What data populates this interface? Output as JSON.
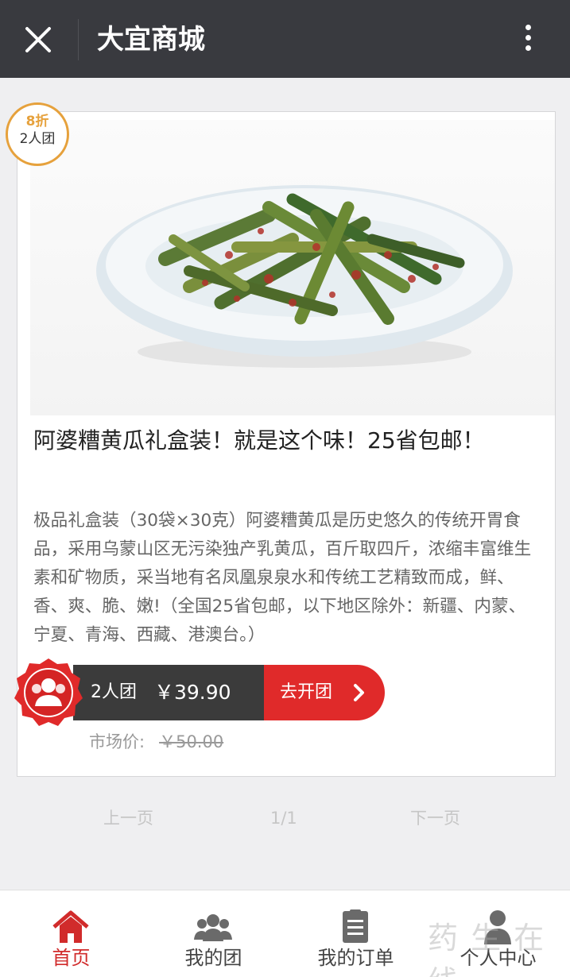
{
  "header": {
    "title": "大宜商城",
    "close_icon": "close-icon",
    "more_icon": "more-vertical-icon"
  },
  "product": {
    "badge": {
      "discount": "8折",
      "group": "2人团"
    },
    "title": "阿婆糟黄瓜礼盒装！就是这个味！25省包邮！",
    "description": "极品礼盒装（30袋×30克）阿婆糟黄瓜是历史悠久的传统开胃食品，采用乌蒙山区无污染独产乳黄瓜，百斤取四斤，浓缩丰富维生素和矿物质，采当地有名凤凰泉泉水和传统工艺精致而成，鲜、香、爽、脆、嫩!（全国25省包邮，以下地区除外：新疆、内蒙、宁夏、青海、西藏、港澳台。）",
    "group_label": "2人团",
    "price": "￥39.90",
    "cta": "去开团",
    "market_label": "市场价:",
    "market_price": "￥50.00"
  },
  "pager": {
    "prev": "上一页",
    "page": "1/1",
    "next": "下一页"
  },
  "tabbar": {
    "items": [
      {
        "label": "首页",
        "icon": "home-icon",
        "active": true
      },
      {
        "label": "我的团",
        "icon": "group-icon",
        "active": false
      },
      {
        "label": "我的订单",
        "icon": "clipboard-icon",
        "active": false
      },
      {
        "label": "个人中心",
        "icon": "user-icon",
        "active": false
      }
    ]
  },
  "watermark": "药 生 在 线",
  "colors": {
    "topbar": "#393a3f",
    "accent": "#e02a2a",
    "badge": "#e6a13c",
    "active_tab": "#d12b2b"
  }
}
